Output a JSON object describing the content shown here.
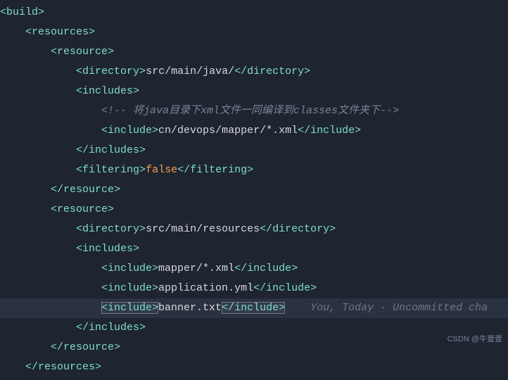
{
  "tags": {
    "build_open": "<build>",
    "resources_open": "<resources>",
    "resources_close": "</resources>",
    "resource_open": "<resource>",
    "resource_close": "</resource>",
    "directory_open": "<directory>",
    "directory_close": "</directory>",
    "includes_open": "<includes>",
    "includes_close": "</includes>",
    "include_open": "<include>",
    "include_close": "</include>",
    "filtering_open": "<filtering>",
    "filtering_close": "</filtering>"
  },
  "values": {
    "dir1": "src/main/java/",
    "dir2": "src/main/resources",
    "comment": "<!-- 将java目录下xml文件一同编译到classes文件夹下-->",
    "include1": "cn/devops/mapper/*.xml",
    "include2": "mapper/*.xml",
    "include3": "application.yml",
    "include4": "banner.txt",
    "filtering": "false"
  },
  "vcs_hint": "You, Today · Uncommitted cha",
  "watermark": "CSDN @牛壹壹",
  "indent_unit": "    "
}
